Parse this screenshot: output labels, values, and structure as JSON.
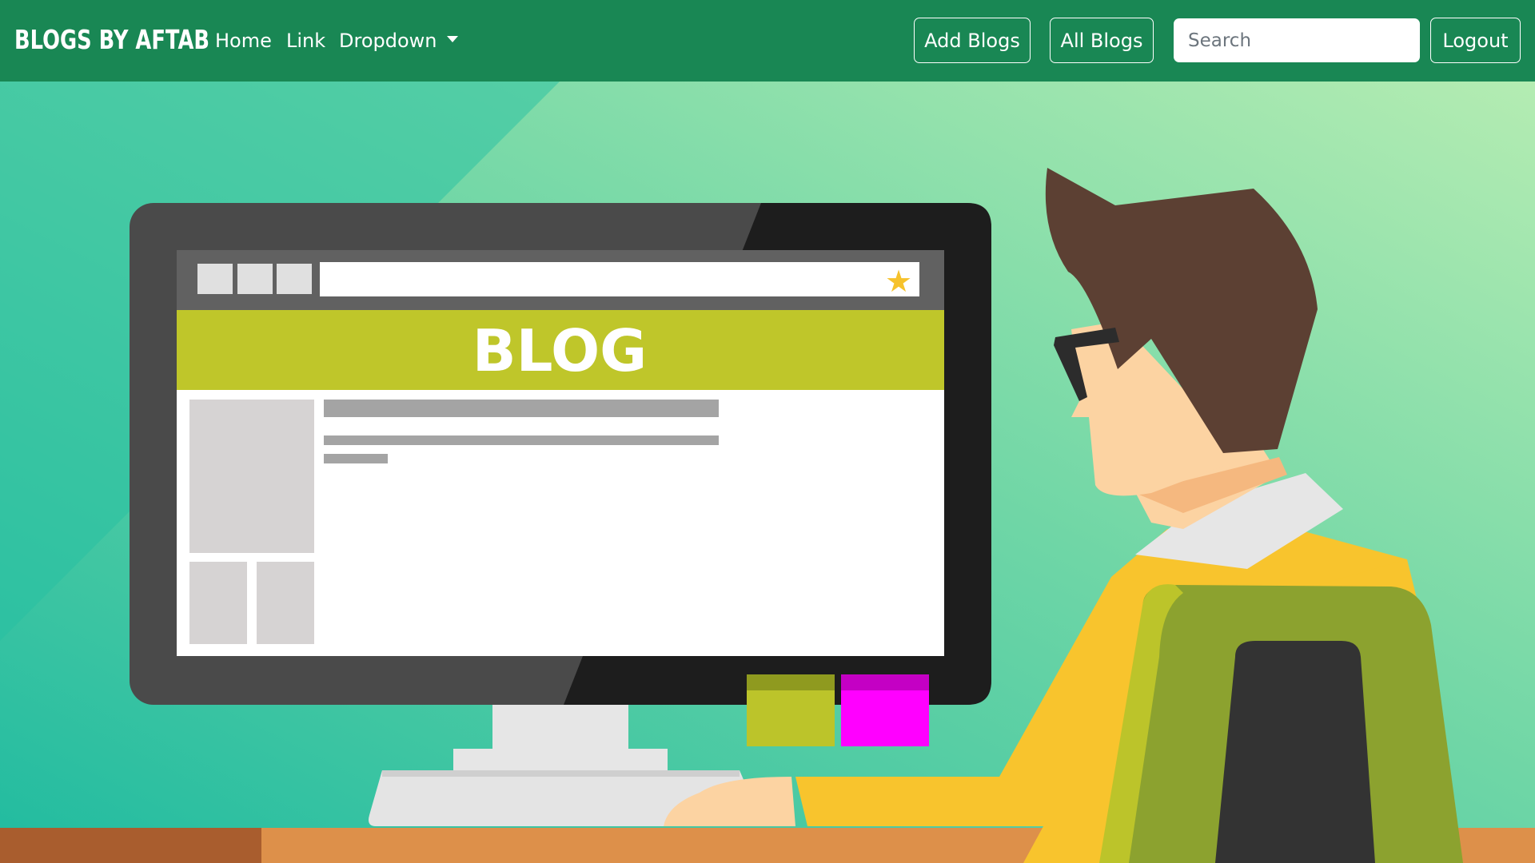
{
  "navbar": {
    "brand": "BLOGS BY AFTAB",
    "links": {
      "home": "Home",
      "link": "Link",
      "dropdown": "Dropdown"
    },
    "add_blogs_label": "Add Blogs",
    "all_blogs_label": "All Blogs",
    "search_placeholder": "Search",
    "logout_label": "Logout",
    "background_color": "#198754"
  },
  "hero": {
    "screen_banner_text": "BLOG",
    "bookmark_icon": "star-icon",
    "colors": {
      "background_start": "#20bba0",
      "background_end": "#aee8b0",
      "banner": "#bfc62a",
      "sweater": "#f8c42d",
      "chair": "#8ca22f",
      "hair": "#5c4033",
      "skin": "#fcd3a2",
      "sticky_green": "#bcc42a",
      "sticky_magenta": "#ff00ff",
      "desk": "#dd904a"
    }
  }
}
